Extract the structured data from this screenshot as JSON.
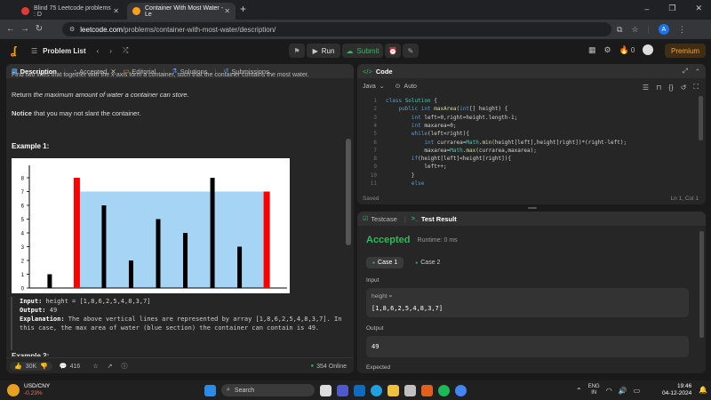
{
  "browser": {
    "tabs": [
      {
        "title": "Blind 75 Leetcode problems : D",
        "favicon_color": "#e53935"
      },
      {
        "title": "Container With Most Water - Le",
        "favicon_color": "#ffa116"
      }
    ],
    "new_tab": "+",
    "url_domain": "leetcode.com",
    "url_path": "/problems/container-with-most-water/description/",
    "window_controls": [
      "–",
      "❐",
      "✕"
    ]
  },
  "header": {
    "problem_list": "Problem List",
    "run": "Run",
    "submit": "Submit",
    "streak": "0",
    "premium": "Premium"
  },
  "description": {
    "tabs": [
      "Description",
      "Accepted",
      "Editorial",
      "Solutions",
      "Submissions"
    ],
    "cut_line": "Find two lines that together with the x-axis form a container, such that the container contains the most water.",
    "return_pre": "Return ",
    "return_em": "the maximum amount of water a container can store",
    "return_post": ".",
    "notice_bold": "Notice",
    "notice_rest": " that you may not slant the container.",
    "example_title": "Example 1:",
    "input_label": "Input:",
    "input_value": " height = [1,8,6,2,5,4,8,3,7]",
    "output_label": "Output:",
    "output_value": " 49",
    "expl_label": "Explanation:",
    "expl_text": " The above vertical lines are represented by array [1,8,6,2,5,4,8,3,7]. In this case, the max area of water (blue section) the container can contain is 49.",
    "example2": "Example 2:",
    "likes": "30K",
    "comments": "416",
    "online": "354 Online"
  },
  "chart_data": {
    "type": "bar",
    "values": [
      1,
      8,
      6,
      2,
      5,
      4,
      8,
      3,
      7
    ],
    "highlighted_indices": [
      1,
      8
    ],
    "water_level": 7,
    "ylim": [
      0,
      8
    ],
    "yticks": [
      "0",
      "1",
      "2",
      "3",
      "4",
      "5",
      "6",
      "7",
      "8"
    ],
    "colors": {
      "bar": "#000000",
      "highlight": "#ff0000",
      "water": "#a6d4f5"
    }
  },
  "code": {
    "title": "Code",
    "language": "Java",
    "mode": "Auto",
    "lines": [
      "class Solution {",
      "    public int maxArea(int[] height) {",
      "        int left=0,right=height.length-1;",
      "        int maxarea=0;",
      "        while(left<right){",
      "            int currarea=Math.min(height[left],height[right])*(right-left);",
      "            maxarea=Math.max(currarea,maxarea);",
      "        if(height[left]<height[right]){",
      "            left++;",
      "        }",
      "        else"
    ],
    "saved": "Saved",
    "position": "Ln 1, Col 1"
  },
  "result": {
    "tabs": [
      "Testcase",
      "Test Result"
    ],
    "status": "Accepted",
    "runtime": "Runtime: 0 ms",
    "cases": [
      "Case 1",
      "Case 2"
    ],
    "input_label": "Input",
    "input_var": "height =",
    "input_value": "[1,8,6,2,5,4,8,3,7]",
    "output_label": "Output",
    "output_value": "49",
    "expected_label": "Expected"
  },
  "taskbar": {
    "ticker_name": "USD/CNY",
    "ticker_change": "-0.23%",
    "search": "Search",
    "lang": "ENG",
    "region": "IN",
    "time": "19:46",
    "date": "04-12-2024"
  }
}
